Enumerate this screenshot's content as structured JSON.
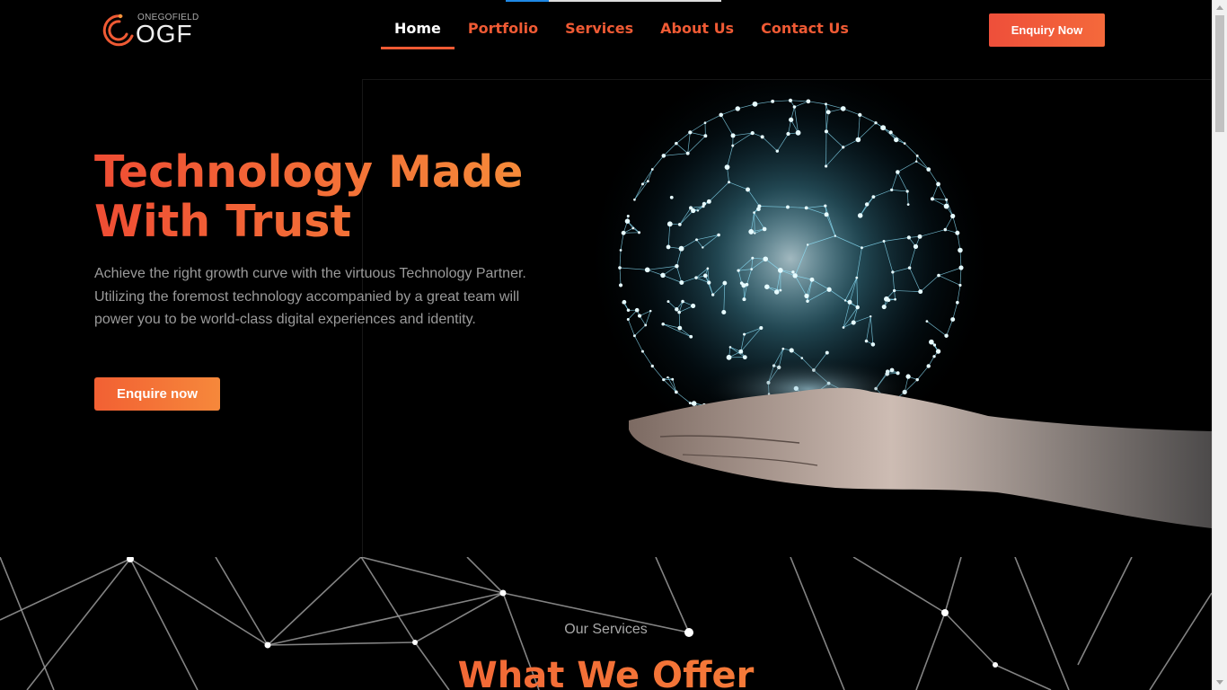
{
  "logo": {
    "tagline": "ONEGOFIELD",
    "wordmark": "OGF"
  },
  "nav": {
    "items": [
      {
        "label": "Home",
        "active": true
      },
      {
        "label": "Portfolio",
        "active": false
      },
      {
        "label": "Services",
        "active": false
      },
      {
        "label": "About Us",
        "active": false
      },
      {
        "label": "Contact Us",
        "active": false
      }
    ]
  },
  "header": {
    "cta_label": "Enquiry Now"
  },
  "hero": {
    "title_line1": "Technology Made",
    "title_line2": "With Trust",
    "description": "Achieve the right growth curve with the virtuous Technology Partner. Utilizing the foremost technology accompanied by a great team will power you to be world-class digital experiences and identity.",
    "button_label": "Enquire now"
  },
  "services": {
    "eyebrow": "Our Services",
    "title": "What We Offer"
  },
  "colors": {
    "accent": "#ef5a34",
    "gradient_start": "#ef4d34",
    "gradient_end": "#f7953a",
    "globe": "#7fe3ff",
    "background": "#000000"
  },
  "icons": {
    "logo_mark": "orbit-logo-icon"
  }
}
